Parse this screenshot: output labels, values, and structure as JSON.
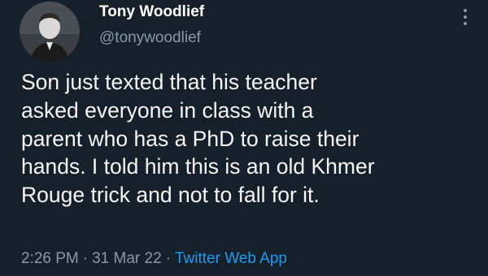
{
  "tweet": {
    "author": {
      "display_name": "Tony Woodlief",
      "handle": "@tonywoodlief"
    },
    "text_lines": [
      "Son just texted that his teacher",
      "asked everyone in class with a",
      "parent who has a PhD to raise their",
      "hands. I told him this is an old Khmer",
      "Rouge trick and not to fall for it."
    ],
    "time": "2:26 PM",
    "date": "31 Mar 22",
    "separator": "·",
    "source": "Twitter Web App"
  },
  "icons": {
    "avatar": "avatar-photo",
    "more": "more-options-icon"
  },
  "colors": {
    "background": "#15202b",
    "primary_text": "#ffffff",
    "secondary_text": "#8b98a5",
    "link": "#1d9bf0"
  }
}
